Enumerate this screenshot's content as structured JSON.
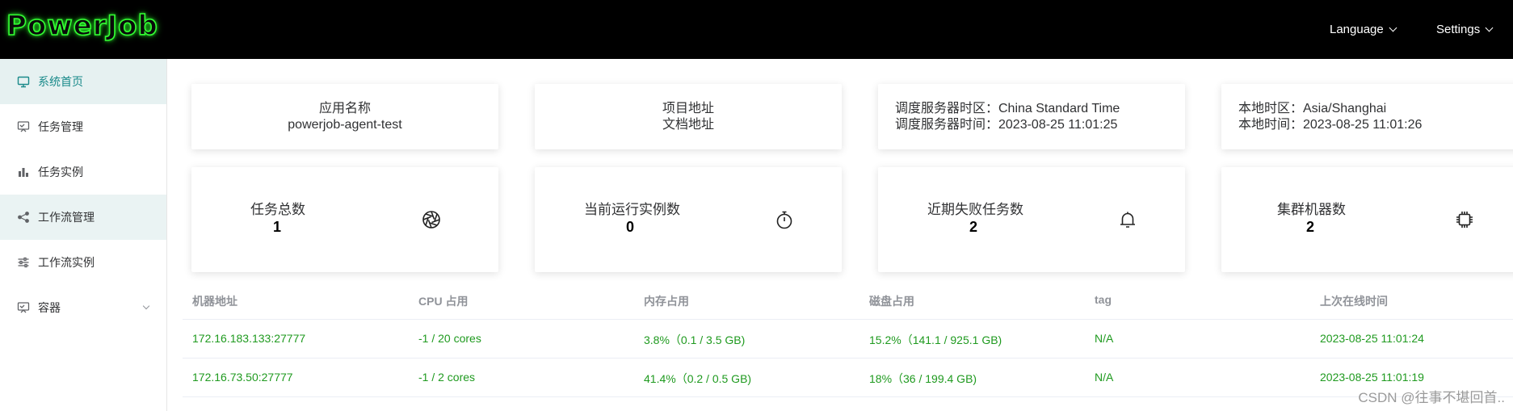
{
  "header": {
    "logo_text": "PowerJob",
    "language_label": "Language",
    "settings_label": "Settings"
  },
  "sidebar": {
    "items": [
      {
        "label": "系统首页",
        "icon": "monitor-icon"
      },
      {
        "label": "任务管理",
        "icon": "task-board-icon"
      },
      {
        "label": "任务实例",
        "icon": "bar-chart-icon"
      },
      {
        "label": "工作流管理",
        "icon": "share-icon"
      },
      {
        "label": "工作流实例",
        "icon": "sliders-icon"
      },
      {
        "label": "容器",
        "icon": "container-icon"
      }
    ]
  },
  "info": {
    "app_name_label": "应用名称",
    "app_name_value": "powerjob-agent-test",
    "project_link": "项目地址",
    "docs_link": "文档地址",
    "server_tz": "调度服务器时区：China Standard Time",
    "server_time": "调度服务器时间：2023-08-25 11:01:25",
    "local_tz": "本地时区：Asia/Shanghai",
    "local_time": "本地时间：2023-08-25 11:01:26"
  },
  "stats": [
    {
      "label": "任务总数",
      "value": "1",
      "icon": "aperture-icon"
    },
    {
      "label": "当前运行实例数",
      "value": "0",
      "icon": "stopwatch-icon"
    },
    {
      "label": "近期失败任务数",
      "value": "2",
      "icon": "bell-icon"
    },
    {
      "label": "集群机器数",
      "value": "2",
      "icon": "cpu-icon"
    }
  ],
  "table": {
    "headers": [
      "机器地址",
      "CPU 占用",
      "内存占用",
      "磁盘占用",
      "tag",
      "上次在线时间"
    ],
    "rows": [
      [
        "172.16.183.133:27777",
        "-1 / 20 cores",
        "3.8%（0.1 / 3.5 GB)",
        "15.2%（141.1 / 925.1 GB)",
        "N/A",
        "2023-08-25 11:01:24"
      ],
      [
        "172.16.73.50:27777",
        "-1 / 2 cores",
        "41.4%（0.2 / 0.5 GB)",
        "18%（36 / 199.4 GB)",
        "N/A",
        "2023-08-25 11:01:19"
      ]
    ]
  },
  "watermark": "CSDN @往事不堪回首..",
  "colors": {
    "accent": "#1a8a8a",
    "table_value": "#1f9a1f",
    "logo_glow": "#33ff33"
  }
}
